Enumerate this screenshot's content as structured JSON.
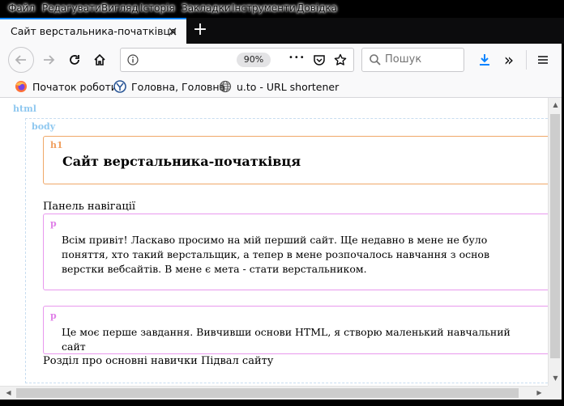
{
  "menu": [
    "Файл",
    "Редагувати",
    "Вигляд",
    "Історія",
    "Закладки",
    "Інструменти",
    "Довідка"
  ],
  "tab": {
    "title": "Сайт верстальника-початківця",
    "close": "×",
    "new": "+"
  },
  "navbar": {
    "zoom": "90%",
    "search_placeholder": "Пошук",
    "more": "•••",
    "overflow": "»"
  },
  "bookmarks": [
    {
      "label": "Початок роботи",
      "icon": "firefox-icon"
    },
    {
      "label": "Головна, Головна",
      "icon": "site-globe-icon"
    },
    {
      "label": "u.to - URL shortener",
      "icon": "globe-icon"
    }
  ],
  "page": {
    "tags": {
      "html": "html",
      "body": "body",
      "h1": "h1",
      "p1": "p",
      "p2": "p"
    },
    "heading": "Сайт верстальника-початківця",
    "nav_text": "Панель навігації",
    "paragraph1": "Всім привіт! Ласкаво просимо на мій перший сайт. Ще недавно в мене не було поняття, хто такий верстальщик, а тепер в мене розпочалось навчання з основ верстки вебсайтів. В мене є мета - стати верстальником.",
    "paragraph2": "Це моє перше завдання. Вивчивши основи HTML, я створю маленький навчальний сайт",
    "footer_text": "Розділ про основні навички Підвал сайту"
  },
  "colors": {
    "html_tag": "#8fc8f0",
    "body_tag": "#8fc8f0",
    "h1_tag": "#f0a060",
    "h1_border": "#f0a868",
    "p_tag": "#e080e8",
    "p_border": "#e898ee",
    "dashed": "#c8ddf0",
    "accent": "#0a84ff"
  }
}
